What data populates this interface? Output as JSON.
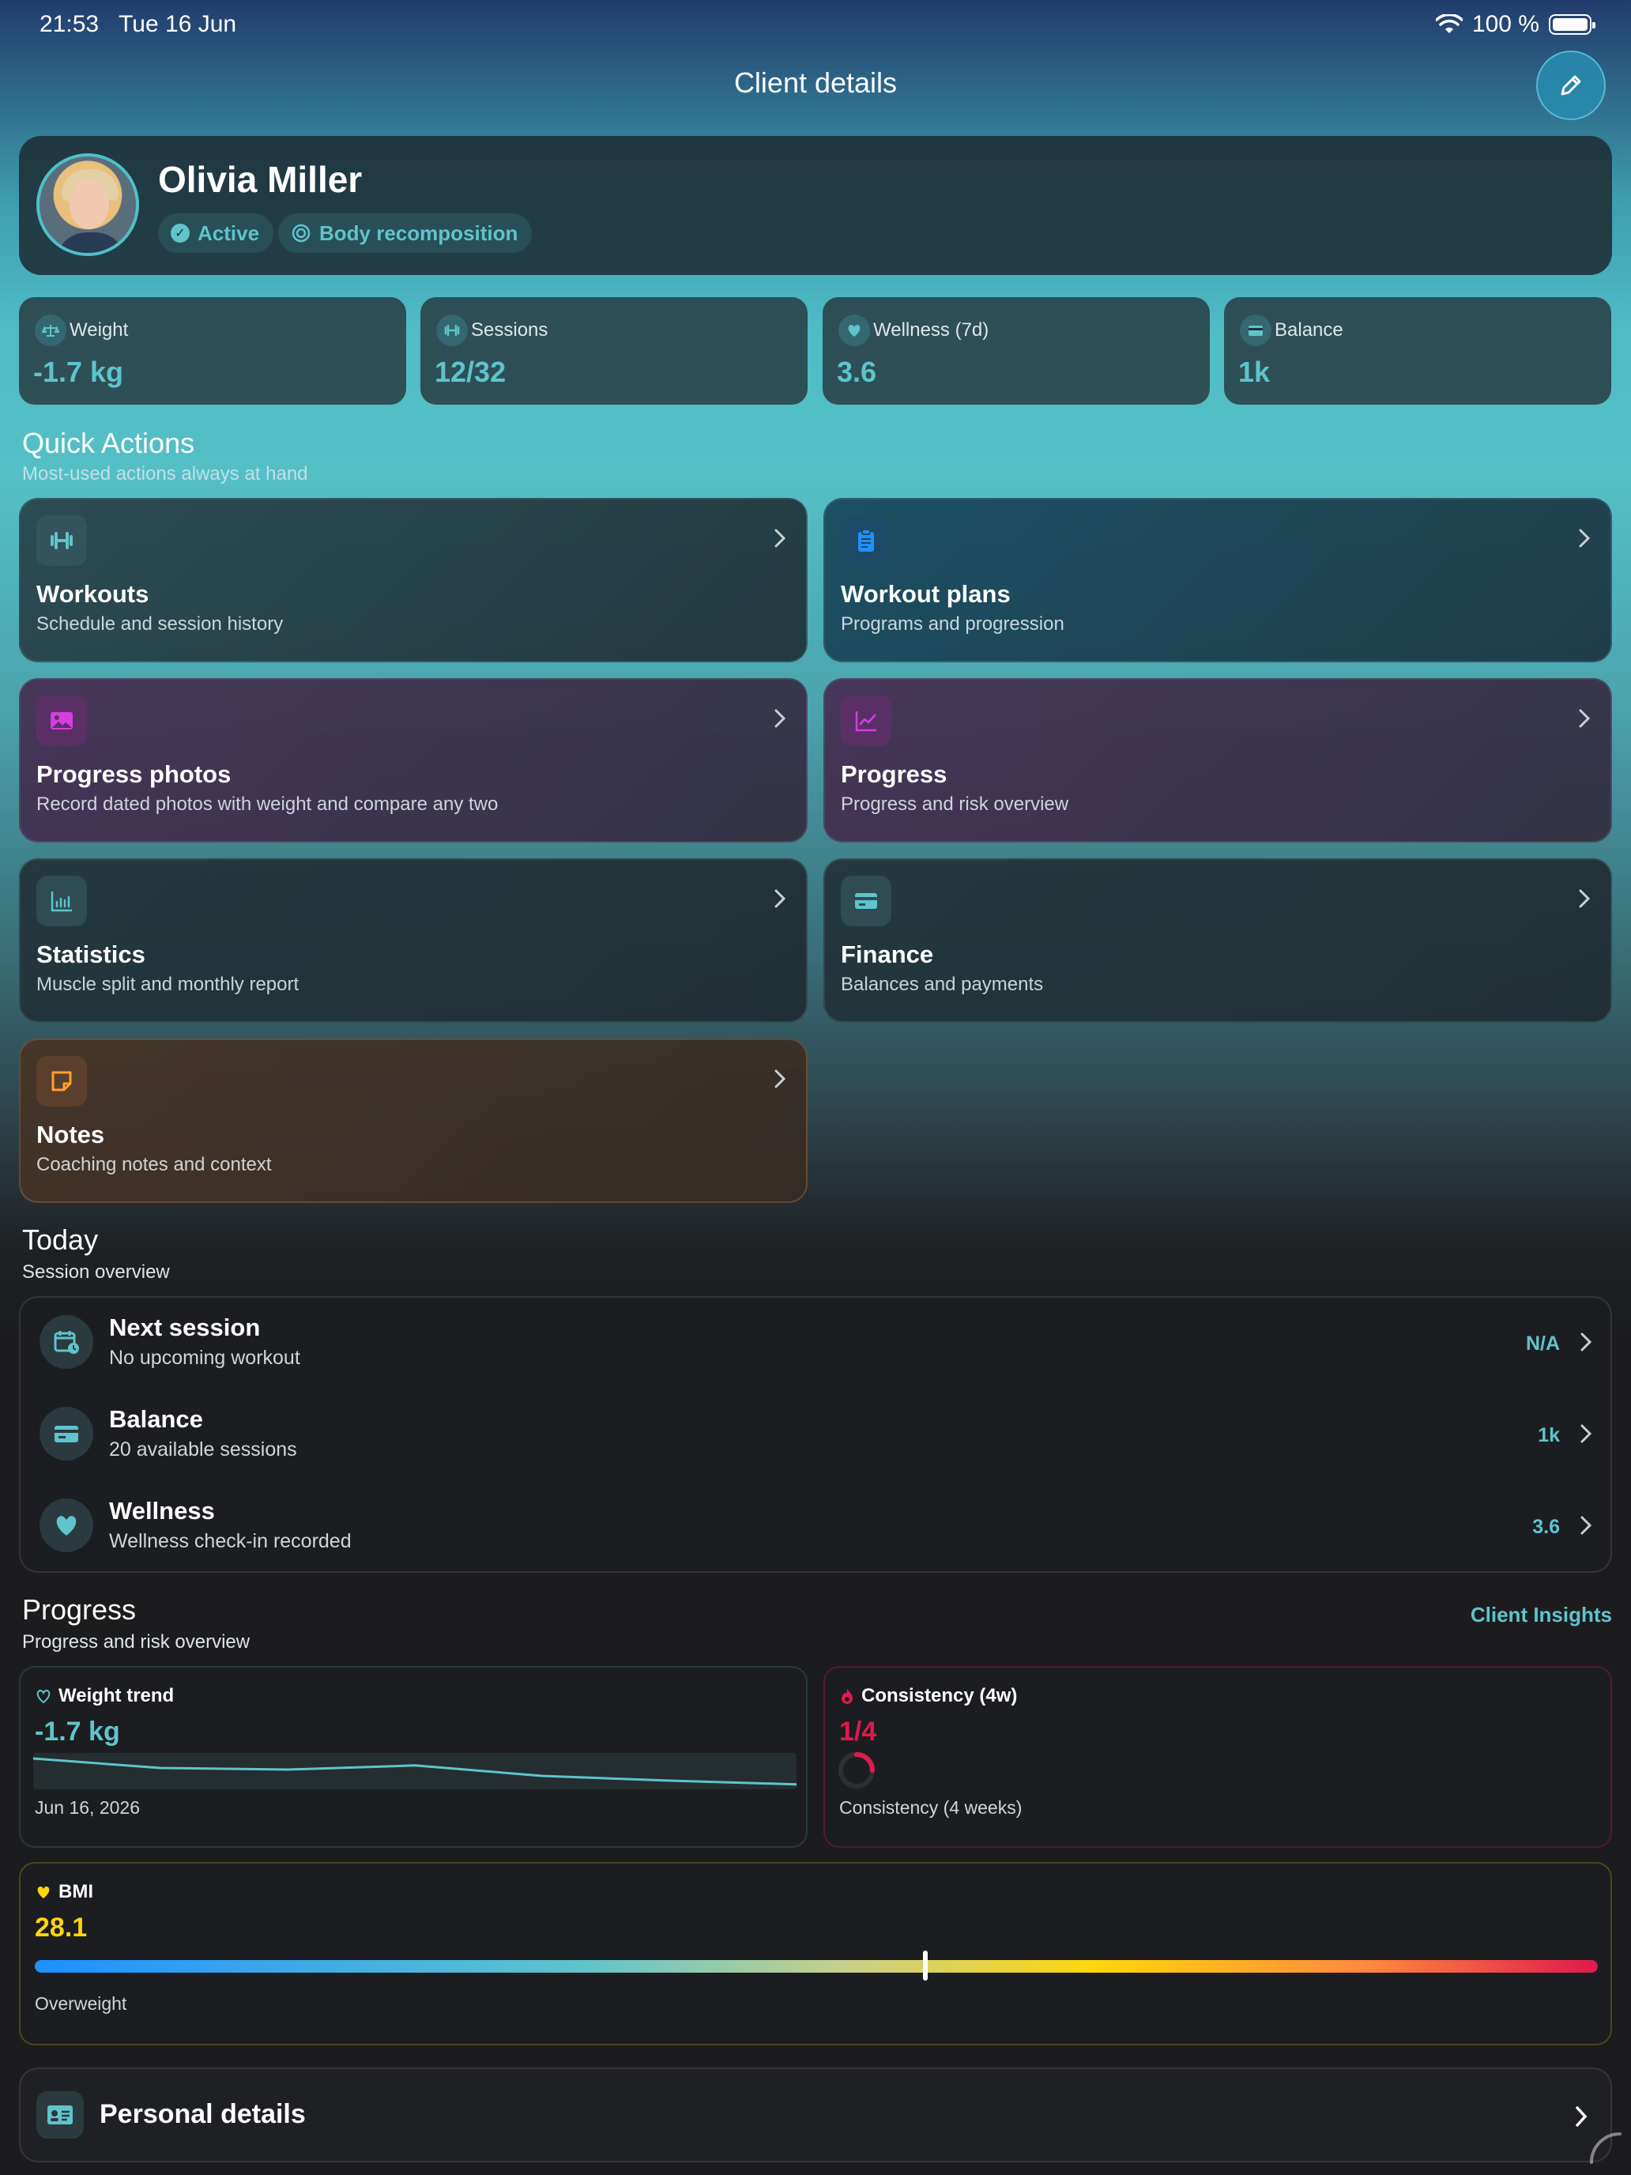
{
  "status_bar": {
    "time": "21:53",
    "date": "Tue 16 Jun",
    "battery": "100 %"
  },
  "nav": {
    "title": "Client details"
  },
  "client": {
    "name": "Olivia Miller",
    "tags": [
      "Active",
      "Body recomposition"
    ]
  },
  "stats": [
    {
      "label": "Weight",
      "value": "-1.7 kg",
      "icon": "scale-icon"
    },
    {
      "label": "Sessions",
      "value": "12/32",
      "icon": "dumbbell-icon"
    },
    {
      "label": "Wellness (7d)",
      "value": "3.6",
      "icon": "heart-icon"
    },
    {
      "label": "Balance",
      "value": "1k",
      "icon": "card-icon"
    }
  ],
  "quick_actions": {
    "title": "Quick Actions",
    "subtitle": "Most-used actions always at hand",
    "items": [
      {
        "title": "Workouts",
        "desc": "Schedule and session history",
        "icon": "dumbbell-icon"
      },
      {
        "title": "Workout plans",
        "desc": "Programs and progression",
        "icon": "clipboard-icon"
      },
      {
        "title": "Progress photos",
        "desc": "Record dated photos with weight and compare any two",
        "icon": "photo-icon"
      },
      {
        "title": "Progress",
        "desc": "Progress and risk overview",
        "icon": "line-chart-icon"
      },
      {
        "title": "Statistics",
        "desc": "Muscle split and monthly report",
        "icon": "bar-chart-icon"
      },
      {
        "title": "Finance",
        "desc": "Balances and payments",
        "icon": "card-icon"
      },
      {
        "title": "Notes",
        "desc": "Coaching notes and context",
        "icon": "note-icon"
      }
    ]
  },
  "today": {
    "title": "Today",
    "subtitle": "Session overview",
    "rows": [
      {
        "title": "Next session",
        "subtitle": "No upcoming workout",
        "value": "N/A",
        "icon": "calendar-clock-icon"
      },
      {
        "title": "Balance",
        "subtitle": "20 available sessions",
        "value": "1k",
        "icon": "card-icon"
      },
      {
        "title": "Wellness",
        "subtitle": "Wellness check-in recorded",
        "value": "3.6",
        "icon": "heart-icon"
      }
    ]
  },
  "progress": {
    "title": "Progress",
    "subtitle": "Progress and risk overview",
    "link": "Client Insights",
    "weight_trend": {
      "title": "Weight trend",
      "value": "-1.7 kg",
      "date": "Jun 16, 2026",
      "line_values": [
        0.9,
        0.6,
        0.55,
        0.68,
        0.35,
        0.2,
        0.08
      ]
    },
    "consistency": {
      "title": "Consistency (4w)",
      "value": "1/4",
      "fraction": 0.25,
      "footer": "Consistency (4 weeks)"
    },
    "bmi": {
      "title": "BMI",
      "value": "28.1",
      "category": "Overweight",
      "marker_fraction": 0.57
    }
  },
  "personal": {
    "label": "Personal details"
  },
  "colors": {
    "accent": "#5fc4cc",
    "consistency": "#e0194f",
    "bmi": "#ffd60a"
  }
}
